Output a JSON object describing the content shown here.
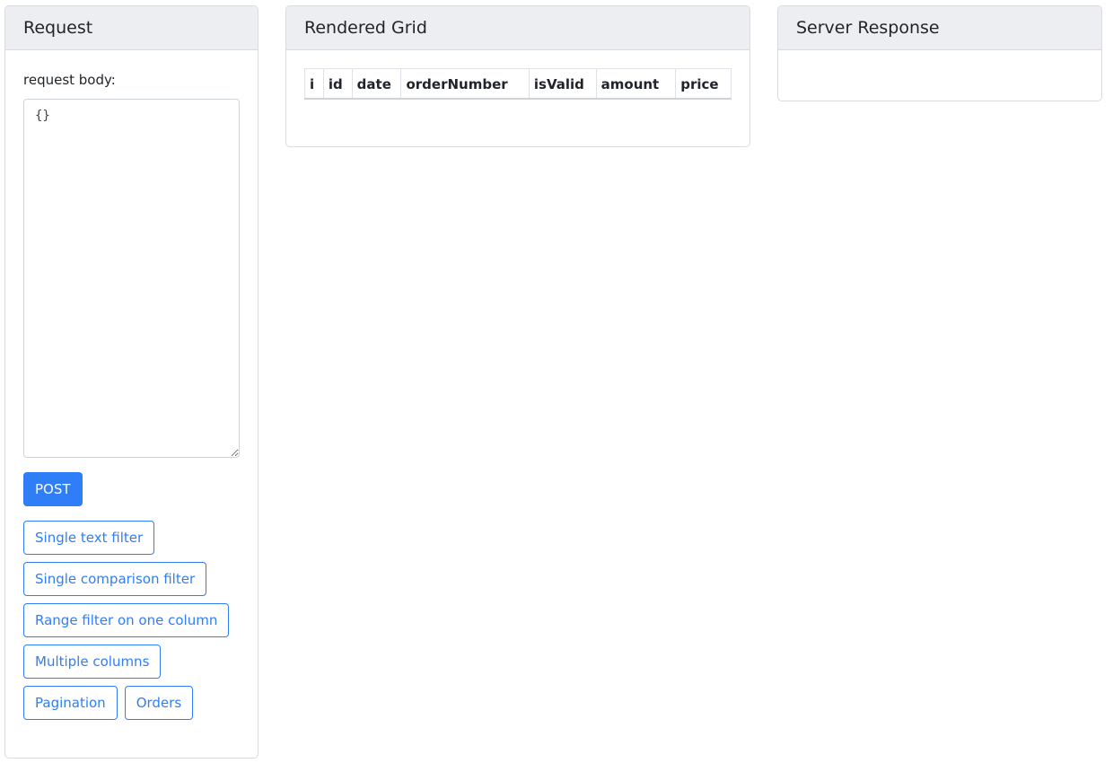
{
  "request": {
    "title": "Request",
    "body_label": "request body:",
    "body_value": "{}",
    "post_label": "POST",
    "preset_buttons": [
      "Single text filter",
      "Single comparison filter",
      "Range filter on one column",
      "Multiple columns",
      "Pagination",
      "Orders"
    ]
  },
  "grid": {
    "title": "Rendered Grid",
    "columns": [
      "i",
      "id",
      "date",
      "orderNumber",
      "isValid",
      "amount",
      "price"
    ]
  },
  "response": {
    "title": "Server Response"
  },
  "colors": {
    "primary": "#2f7ef7",
    "header_bg": "#eceef2",
    "border": "#d9dbde"
  }
}
